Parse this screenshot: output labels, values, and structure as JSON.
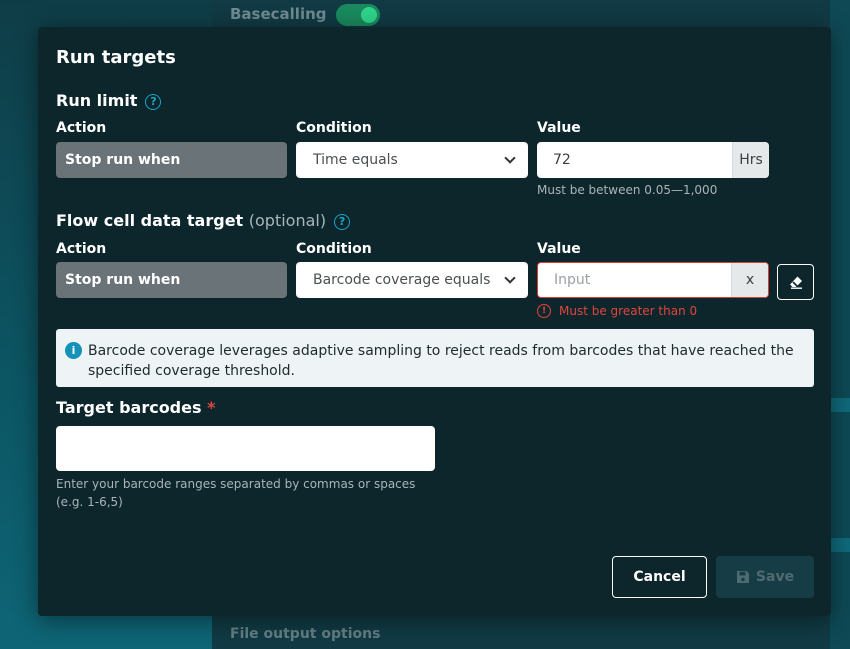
{
  "background": {
    "basecalling_label": "Basecalling",
    "file_output_label": "File output options"
  },
  "modal": {
    "title": "Run targets",
    "run_limit": {
      "title": "Run limit",
      "action_label": "Action",
      "condition_label": "Condition",
      "value_label": "Value",
      "action_value": "Stop run when",
      "condition_value": "Time equals",
      "value": "72",
      "unit": "Hrs",
      "hint": "Must be between 0.05—1,000"
    },
    "flow_cell": {
      "title": "Flow cell data target",
      "optional": "(optional)",
      "action_label": "Action",
      "condition_label": "Condition",
      "value_label": "Value",
      "action_value": "Stop run when",
      "condition_value": "Barcode coverage equals",
      "value_placeholder": "Input",
      "clear_label": "x",
      "error": "Must be greater than 0"
    },
    "info": "Barcode coverage leverages adaptive sampling to reject reads from barcodes that have reached the specified coverage threshold.",
    "target_barcodes": {
      "title": "Target barcodes",
      "required_mark": "*",
      "value": "",
      "helper_line1": "Enter your barcode ranges separated by commas or spaces",
      "helper_line2": "(e.g. 1-6,5)"
    },
    "buttons": {
      "cancel": "Cancel",
      "save": "Save"
    }
  }
}
